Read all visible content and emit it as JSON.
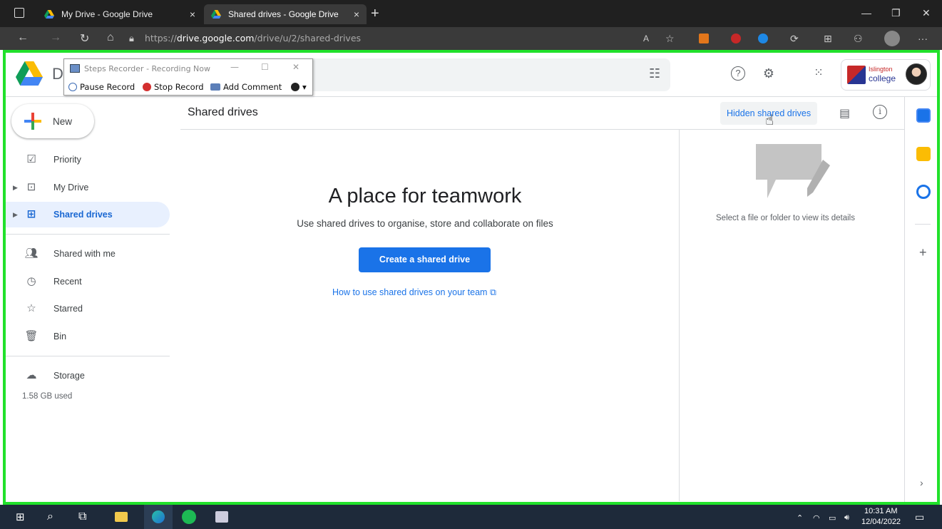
{
  "browser": {
    "tabs": [
      {
        "title": "My Drive - Google Drive",
        "close": "×"
      },
      {
        "title": "Shared drives - Google Drive",
        "close": "×"
      }
    ],
    "new_tab": "+",
    "url_prefix": "https://",
    "url_host": "drive.google.com",
    "url_path": "/drive/u/2/shared-drives",
    "more": "···"
  },
  "steps_recorder": {
    "title": "Steps Recorder - Recording Now",
    "pause_label": "Pause Record",
    "stop_label": "Stop Record",
    "comment_label": "Add Comment"
  },
  "header": {
    "logo_text": "Di",
    "org_line1": "Islington",
    "org_line2": "college"
  },
  "sidebar": {
    "new_label": "New",
    "items": [
      {
        "label": "Priority",
        "icon": "priority-icon"
      },
      {
        "label": "My Drive",
        "icon": "my-drive-icon"
      },
      {
        "label": "Shared drives",
        "icon": "shared-drives-icon"
      },
      {
        "label": "Shared with me",
        "icon": "shared-with-me-icon"
      },
      {
        "label": "Recent",
        "icon": "clock-icon"
      },
      {
        "label": "Starred",
        "icon": "star-icon"
      },
      {
        "label": "Bin",
        "icon": "bin-icon"
      },
      {
        "label": "Storage",
        "icon": "cloud-icon"
      }
    ],
    "storage_used": "1.58 GB used"
  },
  "main": {
    "title": "Shared drives",
    "hidden_link": "Hidden shared drives",
    "empty_title": "A place for teamwork",
    "empty_subtitle": "Use shared drives to organise, store and collaborate on files",
    "create_button": "Create a shared drive",
    "howto_link": "How to use shared drives on your team"
  },
  "details": {
    "placeholder": "Select a file or folder to view its details"
  },
  "taskbar": {
    "time": "10:31 AM",
    "date": "12/04/2022"
  },
  "colors": {
    "accent": "#1a73e8",
    "frame": "#21e12b",
    "active_nav_bg": "#e8f0fe"
  }
}
